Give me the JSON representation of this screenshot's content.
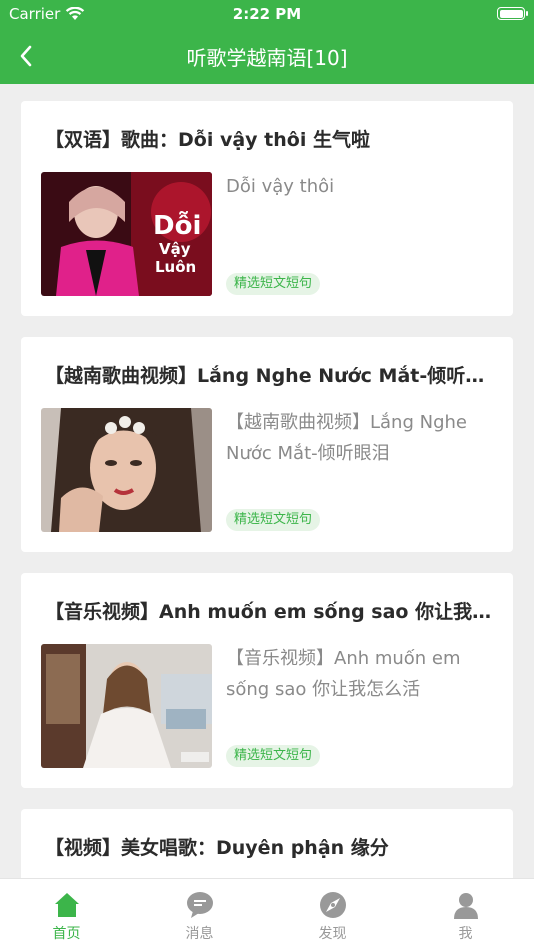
{
  "status": {
    "carrier": "Carrier",
    "time": "2:22 PM"
  },
  "nav": {
    "title": "听歌学越南语[10]"
  },
  "cards": [
    {
      "title": "【双语】歌曲：Dỗi vậy thôi 生气啦",
      "desc": "Dỗi vậy thôi",
      "tag": "精选短文短句"
    },
    {
      "title": "【越南歌曲视频】Lắng Nghe Nước Mắt-倾听…",
      "desc": "【越南歌曲视频】Lắng Nghe Nước Mắt-倾听眼泪",
      "tag": "精选短文短句"
    },
    {
      "title": "【音乐视频】Anh muốn em sống sao 你让我…",
      "desc": "【音乐视频】Anh muốn em sống sao 你让我怎么活",
      "tag": "精选短文短句"
    },
    {
      "title": "【视频】美女唱歌：Duyên phận 缘分"
    }
  ],
  "tabs": [
    {
      "label": "首页",
      "icon": "home-icon",
      "active": true
    },
    {
      "label": "消息",
      "icon": "message-icon",
      "active": false
    },
    {
      "label": "发现",
      "icon": "discover-icon",
      "active": false
    },
    {
      "label": "我",
      "icon": "profile-icon",
      "active": false
    }
  ],
  "colors": {
    "accent": "#3cb54a",
    "tag_bg": "#e6f4e6",
    "background": "#eeeeee"
  }
}
